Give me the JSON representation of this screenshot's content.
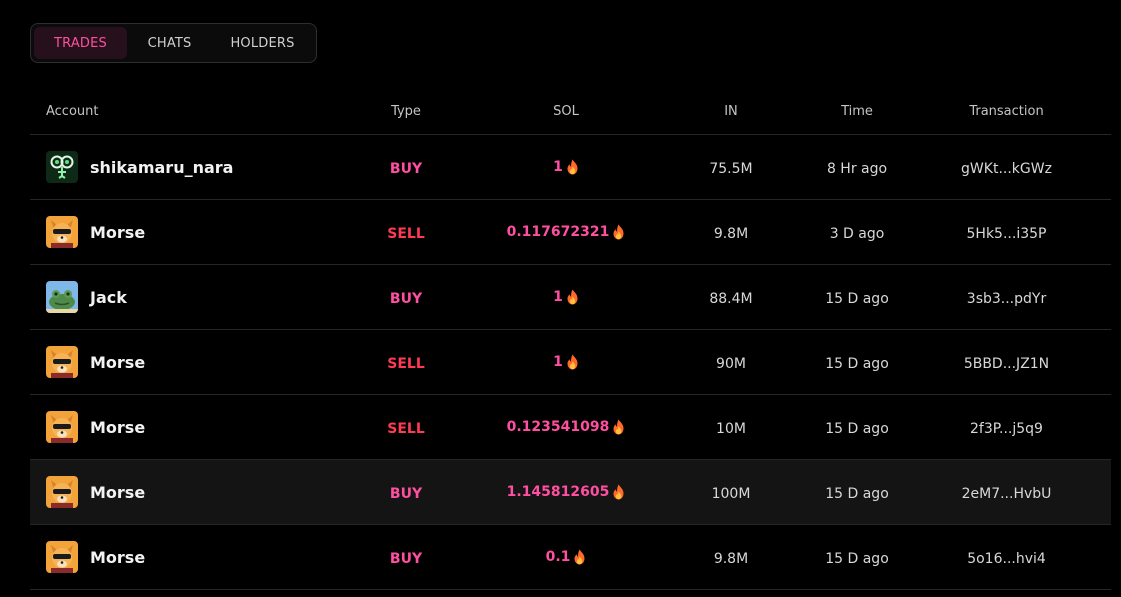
{
  "tabs": [
    {
      "label": "TRADES",
      "active": true
    },
    {
      "label": "CHATS",
      "active": false
    },
    {
      "label": "HOLDERS",
      "active": false
    }
  ],
  "columns": {
    "account": "Account",
    "type": "Type",
    "sol": "SOL",
    "in": "IN",
    "time": "Time",
    "transaction": "Transaction"
  },
  "colors": {
    "buy": "#ff4fa0",
    "sell": "#ff3b52",
    "accent": "#ff4fa0"
  },
  "rows": [
    {
      "account": "shikamaru_nara",
      "avatar": "cartoon-avatar",
      "type": "BUY",
      "sol": "1",
      "in": "75.5M",
      "time": "8 Hr ago",
      "tx": "gWKt...kGWz"
    },
    {
      "account": "Morse",
      "avatar": "dog-avatar",
      "type": "SELL",
      "sol": "0.117672321",
      "in": "9.8M",
      "time": "3 D ago",
      "tx": "5Hk5...i35P"
    },
    {
      "account": "Jack",
      "avatar": "frog-avatar",
      "type": "BUY",
      "sol": "1",
      "in": "88.4M",
      "time": "15 D ago",
      "tx": "3sb3...pdYr"
    },
    {
      "account": "Morse",
      "avatar": "dog-avatar",
      "type": "SELL",
      "sol": "1",
      "in": "90M",
      "time": "15 D ago",
      "tx": "5BBD...JZ1N"
    },
    {
      "account": "Morse",
      "avatar": "dog-avatar",
      "type": "SELL",
      "sol": "0.123541098",
      "in": "10M",
      "time": "15 D ago",
      "tx": "2f3P...j5q9"
    },
    {
      "account": "Morse",
      "avatar": "dog-avatar",
      "type": "BUY",
      "sol": "1.145812605",
      "in": "100M",
      "time": "15 D ago",
      "tx": "2eM7...HvbU"
    },
    {
      "account": "Morse",
      "avatar": "dog-avatar",
      "type": "BUY",
      "sol": "0.1",
      "in": "9.8M",
      "time": "15 D ago",
      "tx": "5o16...hvi4"
    }
  ]
}
